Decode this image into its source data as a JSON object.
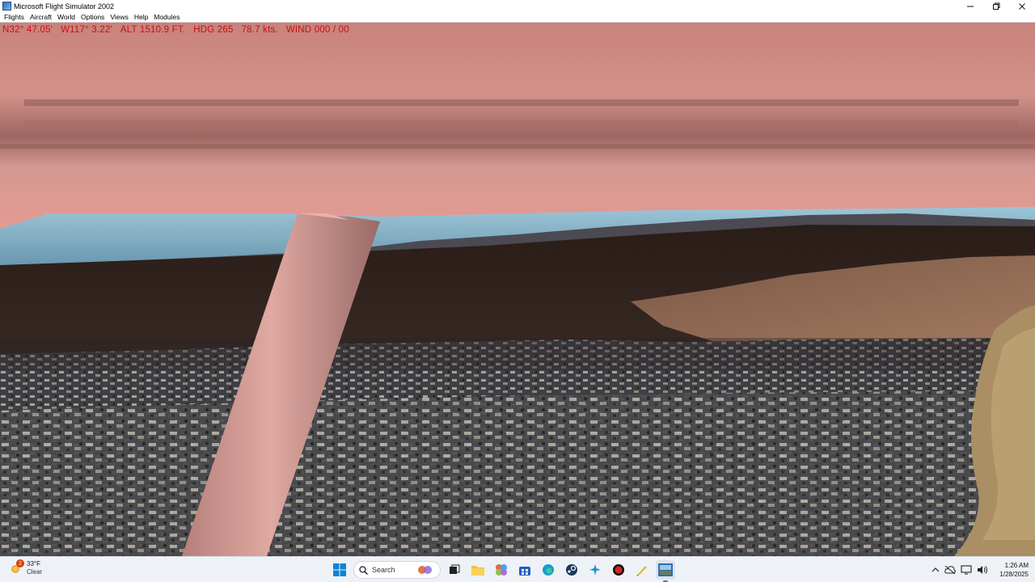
{
  "window": {
    "title": "Microsoft Flight Simulator 2002"
  },
  "window_controls": [
    "minimize-icon",
    "restore-icon",
    "close-icon"
  ],
  "menu": [
    "Flights",
    "Aircraft",
    "World",
    "Options",
    "Views",
    "Help",
    "Modules"
  ],
  "hud": {
    "lat": "N32° 47.05'",
    "lon": "W117° 3.22'",
    "alt": "ALT  1510.9 FT.",
    "hdg": "HDG 265",
    "speed": "78.7 kts.",
    "wind": "WIND 000 / 00",
    "color": "#c81010"
  },
  "taskbar": {
    "weather": {
      "temp": "33°F",
      "condition": "Clear",
      "badge": "2"
    },
    "search_placeholder": "Search",
    "apps": [
      "start-icon",
      "search-icon",
      "copilot-icon",
      "task-view-icon",
      "file-explorer-icon",
      "teams-icon",
      "store-icon",
      "edge-icon",
      "steam-icon",
      "flight-sim-icon",
      "record-icon",
      "pen-icon",
      "active-app-icon"
    ],
    "tray_icons": [
      "chevron-up-icon",
      "cloud-icon",
      "display-icon",
      "volume-icon"
    ],
    "time": "1:26 AM",
    "date": "1/28/2025"
  },
  "colors": {
    "accent": "#0067c0",
    "wing": "#d98f88",
    "sky": "#8cb4c9"
  }
}
